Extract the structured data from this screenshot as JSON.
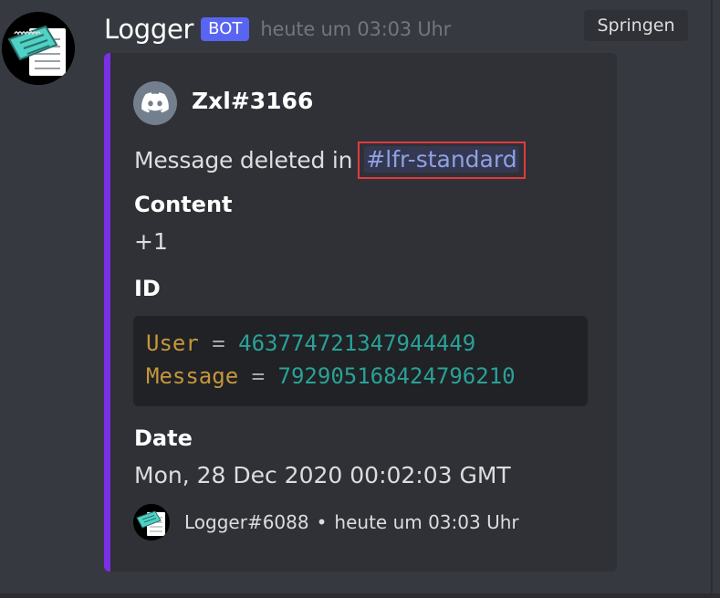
{
  "message": {
    "author": "Logger",
    "bot_tag": "BOT",
    "timestamp": "heute um 03:03 Uhr",
    "avatar_icon": "notepad-icon"
  },
  "jump_button": {
    "label": "Springen"
  },
  "embed": {
    "accent_color": "#7b2fe7",
    "author": {
      "name": "Zxl#3166",
      "icon": "discord-logo-icon"
    },
    "description": {
      "text": "Message deleted in",
      "channel_mention": "#lfr-standard"
    },
    "fields": [
      {
        "name": "Content",
        "value": "+1"
      },
      {
        "name": "ID",
        "code": [
          {
            "key": "User",
            "op": "=",
            "value": "463774721347944449"
          },
          {
            "key": "Message",
            "op": "=",
            "value": "792905168424796210"
          }
        ]
      },
      {
        "name": "Date",
        "value": "Mon, 28 Dec 2020 00:02:03 GMT"
      }
    ],
    "footer": {
      "text": "Logger#6088",
      "separator": "•",
      "timestamp": "heute um 03:03 Uhr",
      "icon": "notepad-icon"
    }
  },
  "colors": {
    "background": "#36393f",
    "embed_background": "#2f3136",
    "mention_text": "#8ea1e1",
    "highlight_box": "#e03a3e",
    "bot_tag": "#5865f2"
  }
}
